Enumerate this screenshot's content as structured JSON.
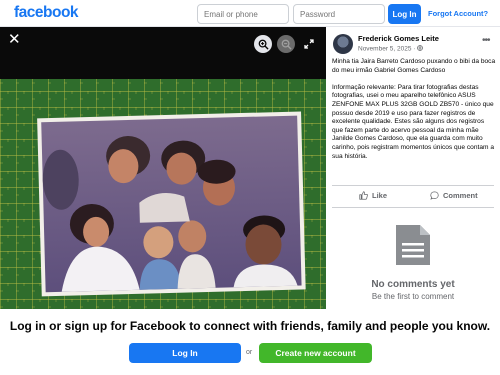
{
  "header": {
    "logo": "facebook",
    "email_placeholder": "Email or phone",
    "password_placeholder": "Password",
    "login_label": "Log In",
    "forgot_label": "Forgot Account?"
  },
  "viewer": {
    "close_icon": "close-icon",
    "zoom_in_icon": "zoom-in-icon",
    "zoom_out_icon": "zoom-out-icon",
    "fullscreen_icon": "fullscreen-icon"
  },
  "post": {
    "author": "Frederick Gomes Leite",
    "date": "November 5, 2025 · ",
    "privacy_icon": "globe-icon",
    "caption_1": "Minha tia Jaira Barreto Cardoso puxando o bibi da boca do meu irmão Gabriel Gomes Cardoso",
    "caption_2": "Informação relevante: Para tirar fotografias destas fotografias, usei o meu aparelho telefônico ASUS ZENFONE MAX PLUS 32GB GOLD ZB570 - único que possuo desde 2019 e uso para fazer registros de excelente qualidade. Estes são alguns dos registros que fazem parte do acervo pessoal da minha mãe Janilde Gomes Cardoso, que ela guarda com muito carinho, pois registram momentos únicos que contam a sua história.",
    "like_label": "Like",
    "comment_label": "Comment",
    "no_comments": "No comments yet",
    "be_first": "Be the first to comment"
  },
  "footer": {
    "cta": "Log in or sign up for Facebook to connect with friends, family and people you know.",
    "login_label": "Log In",
    "or_label": "or",
    "create_label": "Create new account"
  },
  "colors": {
    "brand": "#1877f2",
    "create": "#42b72a",
    "mat": "#2f6d2c"
  }
}
